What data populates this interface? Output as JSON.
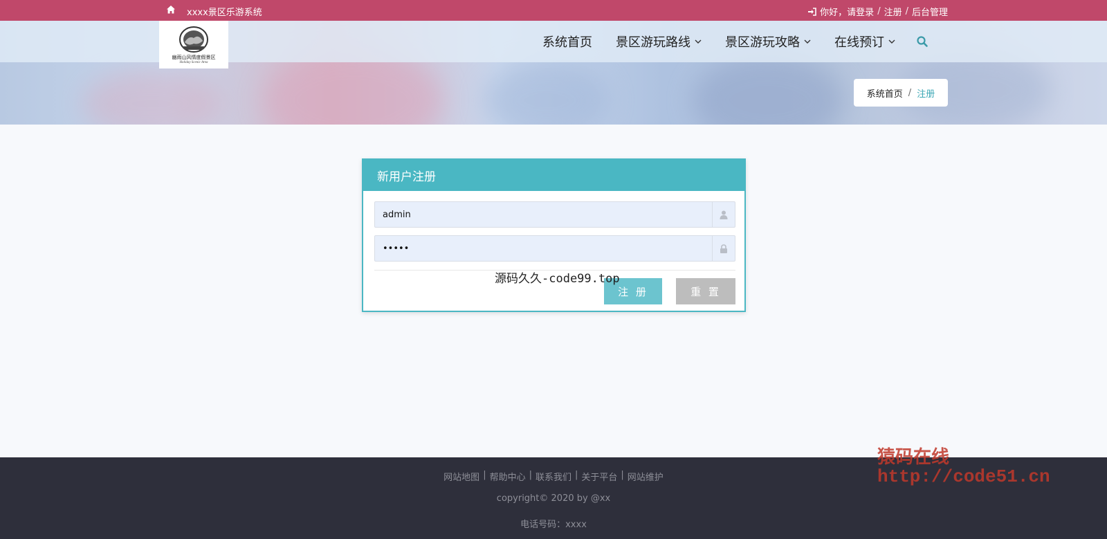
{
  "topbar": {
    "site_name": "xxxx景区乐游系统",
    "greeting": "你好，请登录",
    "sep1": "/",
    "register": "注册",
    "sep2": "/",
    "admin": "后台管理"
  },
  "logo": {
    "caption": "幽雨山风情度假景区",
    "subtitle": "Holiday Scenic Area"
  },
  "nav": {
    "items": [
      "系统首页",
      "景区游玩路线",
      "景区游玩攻略",
      "在线预订"
    ]
  },
  "breadcrumb": {
    "home": "系统首页",
    "sep": "/",
    "current": "注册"
  },
  "form": {
    "title": "新用户注册",
    "username_value": "admin",
    "password_value": "admin",
    "register_label": "注 册",
    "reset_label": "重 置"
  },
  "watermarks": {
    "center": "源码久久-code99.top",
    "corner_cn": "猿码在线",
    "corner_url": "http://code51.cn"
  },
  "footer": {
    "links": [
      "网站地图",
      "帮助中心",
      "联系我们",
      "关于平台",
      "网站维护"
    ],
    "link_sep": "|",
    "copyright": "copyright© 2020 by @xx",
    "phone": "电话号码：xxxx"
  },
  "colors": {
    "topbar": "#c0486a",
    "accent": "#4ab7c3",
    "footer": "#2e2f3b"
  }
}
